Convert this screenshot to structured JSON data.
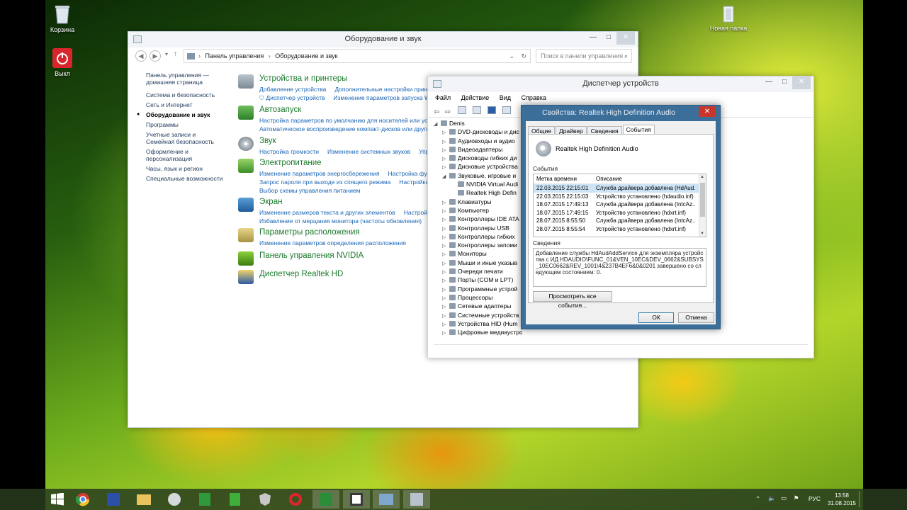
{
  "desktop": {
    "icons": [
      {
        "label": "Корзина"
      },
      {
        "label": "Выкл"
      },
      {
        "label": "Новая папка"
      }
    ]
  },
  "control_panel": {
    "title": "Оборудование и звук",
    "breadcrumb": [
      "Панель управления",
      "Оборудование и звук"
    ],
    "search_placeholder": "Поиск в панели управления",
    "left_nav": [
      "Панель управления — домашняя страница",
      "Система и безопасность",
      "Сеть и Интернет",
      "Оборудование и звук",
      "Программы",
      "Учетные записи и Семейная безопасность",
      "Оформление и персонализация",
      "Часы, язык и регион",
      "Специальные возможности"
    ],
    "categories": [
      {
        "title": "Устройства и принтеры",
        "links": [
          "Добавление устройства",
          "Дополнительные настройки принт",
          "Диспетчер устройств",
          "Изменение параметров запуска W"
        ]
      },
      {
        "title": "Автозапуск",
        "links": [
          "Настройка параметров по умолчанию для носителей или устр",
          "Автоматическое воспроизведение компакт-дисков или други"
        ]
      },
      {
        "title": "Звук",
        "links": [
          "Настройка громкости",
          "Изменение системных звуков",
          "Упр"
        ]
      },
      {
        "title": "Электропитание",
        "links": [
          "Изменение параметров энергосбережения",
          "Настройка фун",
          "Запрос пароля при выходе из спящего режима",
          "Настройка",
          "Выбор схемы управления питанием"
        ]
      },
      {
        "title": "Экран",
        "links": [
          "Изменение размеров текста и других элементов",
          "Настройк",
          "Избавление от мерцания монитора (частоты обновления)"
        ]
      },
      {
        "title": "Параметры расположения",
        "links": [
          "Изменение параметров определения расположения"
        ]
      },
      {
        "title": "Панель управления NVIDIA",
        "links": []
      },
      {
        "title": "Диспетчер Realtek HD",
        "links": []
      }
    ]
  },
  "device_manager": {
    "title": "Диспетчер устройств",
    "menu": [
      "Файл",
      "Действие",
      "Вид",
      "Справка"
    ],
    "tree": [
      {
        "label": "Denis",
        "level": 0,
        "expanded": true
      },
      {
        "label": "DVD-дисководы и дис",
        "level": 1
      },
      {
        "label": "Аудиовходы и аудио",
        "level": 1
      },
      {
        "label": "Видеоадаптеры",
        "level": 1
      },
      {
        "label": "Дисководы гибких ди",
        "level": 1
      },
      {
        "label": "Дисковые устройства",
        "level": 1
      },
      {
        "label": "Звуковые, игровые и",
        "level": 1,
        "expanded": true
      },
      {
        "label": "NVIDIA Virtual Audi",
        "level": 2
      },
      {
        "label": "Realtek High Defin",
        "level": 2
      },
      {
        "label": "Клавиатуры",
        "level": 1
      },
      {
        "label": "Компьютер",
        "level": 1
      },
      {
        "label": "Контроллеры IDE ATA",
        "level": 1
      },
      {
        "label": "Контроллеры USB",
        "level": 1
      },
      {
        "label": "Контроллеры гибких",
        "level": 1
      },
      {
        "label": "Контроллеры запоми",
        "level": 1
      },
      {
        "label": "Мониторы",
        "level": 1
      },
      {
        "label": "Мыши и иные указыв",
        "level": 1
      },
      {
        "label": "Очереди печати",
        "level": 1
      },
      {
        "label": "Порты (COM и LPT)",
        "level": 1
      },
      {
        "label": "Программные устрой",
        "level": 1
      },
      {
        "label": "Процессоры",
        "level": 1
      },
      {
        "label": "Сетевые адаптеры",
        "level": 1
      },
      {
        "label": "Системные устройств",
        "level": 1
      },
      {
        "label": "Устройства HID (Hum",
        "level": 1
      },
      {
        "label": "Цифровые медиаустройства",
        "level": 1
      }
    ]
  },
  "properties": {
    "title": "Свойства: Realtek High Definition Audio",
    "tabs": [
      "Общие",
      "Драйвер",
      "Сведения",
      "События"
    ],
    "selected_tab": "События",
    "device_name": "Realtek High Definition Audio",
    "events_label": "События",
    "columns": [
      "Метка времени",
      "Описание"
    ],
    "events": [
      {
        "time": "22.03.2015 22:15:01",
        "desc": "Служба драйвера добавлена (HdAud...",
        "selected": true
      },
      {
        "time": "22.03.2015 22:15:03",
        "desc": "Устройство установлено (hdaudio.inf)"
      },
      {
        "time": "18.07.2015 17:49:13",
        "desc": "Служба драйвера добавлена (IntcAz..."
      },
      {
        "time": "18.07.2015 17:49:15",
        "desc": "Устройство установлено (hdxrt.inf)"
      },
      {
        "time": "28.07.2015 8:55:50",
        "desc": "Служба драйвера добавлена (IntcAz..."
      },
      {
        "time": "28.07.2015 8:55:54",
        "desc": "Устройство установлено (hdxrt.inf)"
      }
    ],
    "details_label": "Сведения",
    "details_text": "Добавление службы HdAudAddService для экземпляра устройства с ИД HDAUDIO\\FUNC_01&VEN_10EC&DEV_0662&SUBSYS_10EC0662&REV_1001\\4&237B4EF6&0&0201 завершено со следующим состоянием: 0.",
    "view_all_button": "Просмотреть все события...",
    "ok_button": "ОК",
    "cancel_button": "Отмена"
  },
  "taskbar": {
    "language": "РУС",
    "time": "13:58",
    "date": "31.08.2015"
  }
}
